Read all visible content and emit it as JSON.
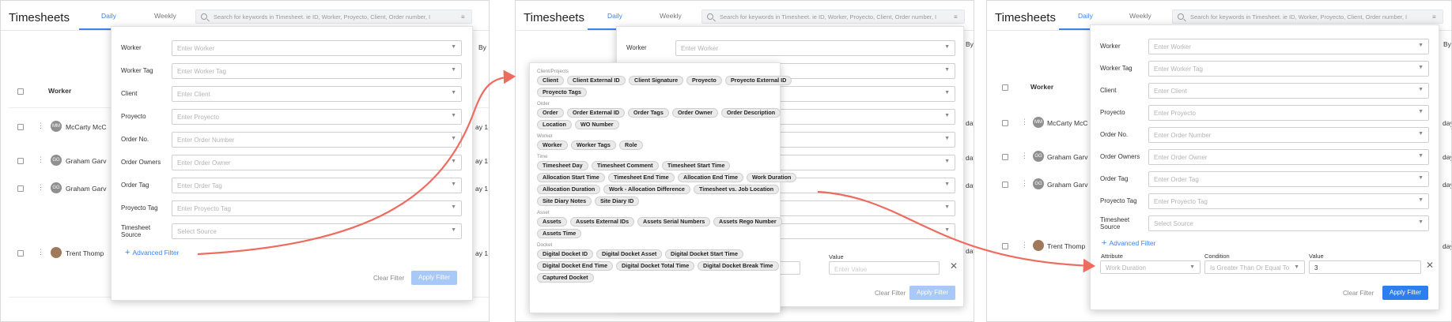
{
  "app": {
    "title": "Timesheets",
    "tabs": [
      "Daily",
      "Weekly"
    ],
    "search_placeholder": "Search for keywords in Timesheet. ie ID, Worker, Proyecto, Client, Order number, I"
  },
  "background": {
    "worker_col": "Worker",
    "by": "By",
    "workers": [
      {
        "initials": "MM",
        "name": "McCarty McC"
      },
      {
        "initials": "GG",
        "name": "Graham Garv"
      },
      {
        "initials": "GG",
        "name": "Graham Garv"
      },
      {
        "initials": "",
        "name": "Trent Thomp"
      }
    ],
    "day": "ay 1",
    "day_label": "day"
  },
  "filter": {
    "fields": [
      {
        "label": "Worker",
        "placeholder": "Enter Worker"
      },
      {
        "label": "Worker Tag",
        "placeholder": "Enter Worker Tag"
      },
      {
        "label": "Client",
        "placeholder": "Enter Client"
      },
      {
        "label": "Proyecto",
        "placeholder": "Enter Proyecto"
      },
      {
        "label": "Order No.",
        "placeholder": "Enter Order Number"
      },
      {
        "label": "Order Owners",
        "placeholder": "Enter Order Owner"
      },
      {
        "label": "Order Tag",
        "placeholder": "Enter Order Tag"
      },
      {
        "label": "Proyecto Tag",
        "placeholder": "Enter Proyecto Tag"
      },
      {
        "label": "Timesheet Source",
        "placeholder": "Select Source"
      }
    ],
    "advanced": "Advanced Filter",
    "clear": "Clear Filter",
    "apply": "Apply Filter",
    "adv_columns": {
      "attribute": "Attribute",
      "condition": "Condition",
      "value": "Value"
    },
    "value_placeholder": "Enter Value",
    "adv_row": {
      "attribute": "Work Duration",
      "condition": "Is Greater Than Or Equal To",
      "value": "3"
    }
  },
  "attribute_groups": [
    {
      "name": "Client/Projects",
      "rows": [
        [
          "Client",
          "Client External ID",
          "Client Signature",
          "Proyecto",
          "Proyecto External ID"
        ],
        [
          "Proyecto Tags"
        ]
      ]
    },
    {
      "name": "Order",
      "rows": [
        [
          "Order",
          "Order External ID",
          "Order Tags",
          "Order Owner",
          "Order Description"
        ],
        [
          "Location",
          "WO Number"
        ]
      ]
    },
    {
      "name": "Worker",
      "rows": [
        [
          "Worker",
          "Worker Tags",
          "Role"
        ]
      ]
    },
    {
      "name": "Time",
      "rows": [
        [
          "Timesheet Day",
          "Timesheet Comment",
          "Timesheet Start Time"
        ],
        [
          "Allocation Start Time",
          "Timesheet End Time",
          "Allocation End Time",
          "Work Duration"
        ],
        [
          "Allocation Duration",
          "Work - Allocation Difference",
          "Timesheet vs. Job Location"
        ],
        [
          "Site Diary Notes",
          "Site Diary ID"
        ]
      ]
    },
    {
      "name": "Asset",
      "rows": [
        [
          "Assets",
          "Assets External IDs",
          "Assets Serial Numbers",
          "Assets Rego Number"
        ],
        [
          "Assets Time"
        ]
      ]
    },
    {
      "name": "Docket",
      "rows": [
        [
          "Digital Docket ID",
          "Digital Docket Asset",
          "Digital Docket Start Time"
        ],
        [
          "Digital Docket End Time",
          "Digital Docket Total Time",
          "Digital Docket Break Time"
        ],
        [
          "Captured Docket"
        ]
      ]
    }
  ],
  "colors": {
    "accent": "#3b82f6",
    "arrow": "#ee6b60",
    "apply_disabled": "#a8c8f8",
    "apply_enabled": "#2d7ff0"
  },
  "icons": [
    "search-icon",
    "filter-icon",
    "chevron-down-icon",
    "plus-icon",
    "close-icon",
    "more-vertical-icon",
    "checkbox-icon"
  ]
}
